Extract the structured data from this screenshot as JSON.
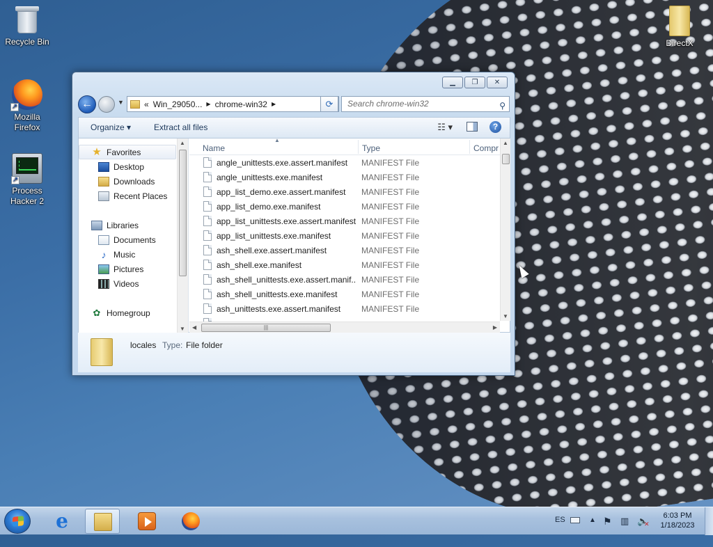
{
  "desktop": {
    "icons": [
      {
        "label": "Recycle Bin",
        "icon": "recycle-bin-icon"
      },
      {
        "label": "Mozilla Firefox",
        "icon": "firefox-icon"
      },
      {
        "label": "Process Hacker 2",
        "icon": "process-hacker-icon"
      },
      {
        "label": "DirectX",
        "icon": "folder-icon"
      }
    ]
  },
  "window": {
    "address": {
      "prefix": "«",
      "segments": [
        "Win_29050...",
        "chrome-win32"
      ]
    },
    "search_placeholder": "Search chrome-win32",
    "toolbar": {
      "organize": "Organize",
      "extract_all": "Extract all files"
    },
    "nav_pane": {
      "favorites": "Favorites",
      "favorites_items": [
        "Desktop",
        "Downloads",
        "Recent Places"
      ],
      "libraries": "Libraries",
      "libraries_items": [
        "Documents",
        "Music",
        "Pictures",
        "Videos"
      ],
      "homegroup": "Homegroup"
    },
    "columns": [
      "Name",
      "Type",
      "Compr"
    ],
    "files": [
      {
        "name": "angle_unittests.exe.assert.manifest",
        "type": "MANIFEST File"
      },
      {
        "name": "angle_unittests.exe.manifest",
        "type": "MANIFEST File"
      },
      {
        "name": "app_list_demo.exe.assert.manifest",
        "type": "MANIFEST File"
      },
      {
        "name": "app_list_demo.exe.manifest",
        "type": "MANIFEST File"
      },
      {
        "name": "app_list_unittests.exe.assert.manifest",
        "type": "MANIFEST File"
      },
      {
        "name": "app_list_unittests.exe.manifest",
        "type": "MANIFEST File"
      },
      {
        "name": "ash_shell.exe.assert.manifest",
        "type": "MANIFEST File"
      },
      {
        "name": "ash_shell.exe.manifest",
        "type": "MANIFEST File"
      },
      {
        "name": "ash_shell_unittests.exe.assert.manif...",
        "type": "MANIFEST File"
      },
      {
        "name": "ash_shell_unittests.exe.manifest",
        "type": "MANIFEST File"
      },
      {
        "name": "ash_unittests.exe.assert.manifest",
        "type": "MANIFEST File"
      }
    ],
    "details": {
      "name": "locales",
      "type_label": "Type:",
      "type_value": "File folder"
    }
  },
  "taskbar": {
    "apps": [
      "internet-explorer",
      "windows-explorer",
      "windows-media-player",
      "firefox"
    ],
    "language": "ES",
    "time": "6:03 PM",
    "date": "1/18/2023"
  }
}
